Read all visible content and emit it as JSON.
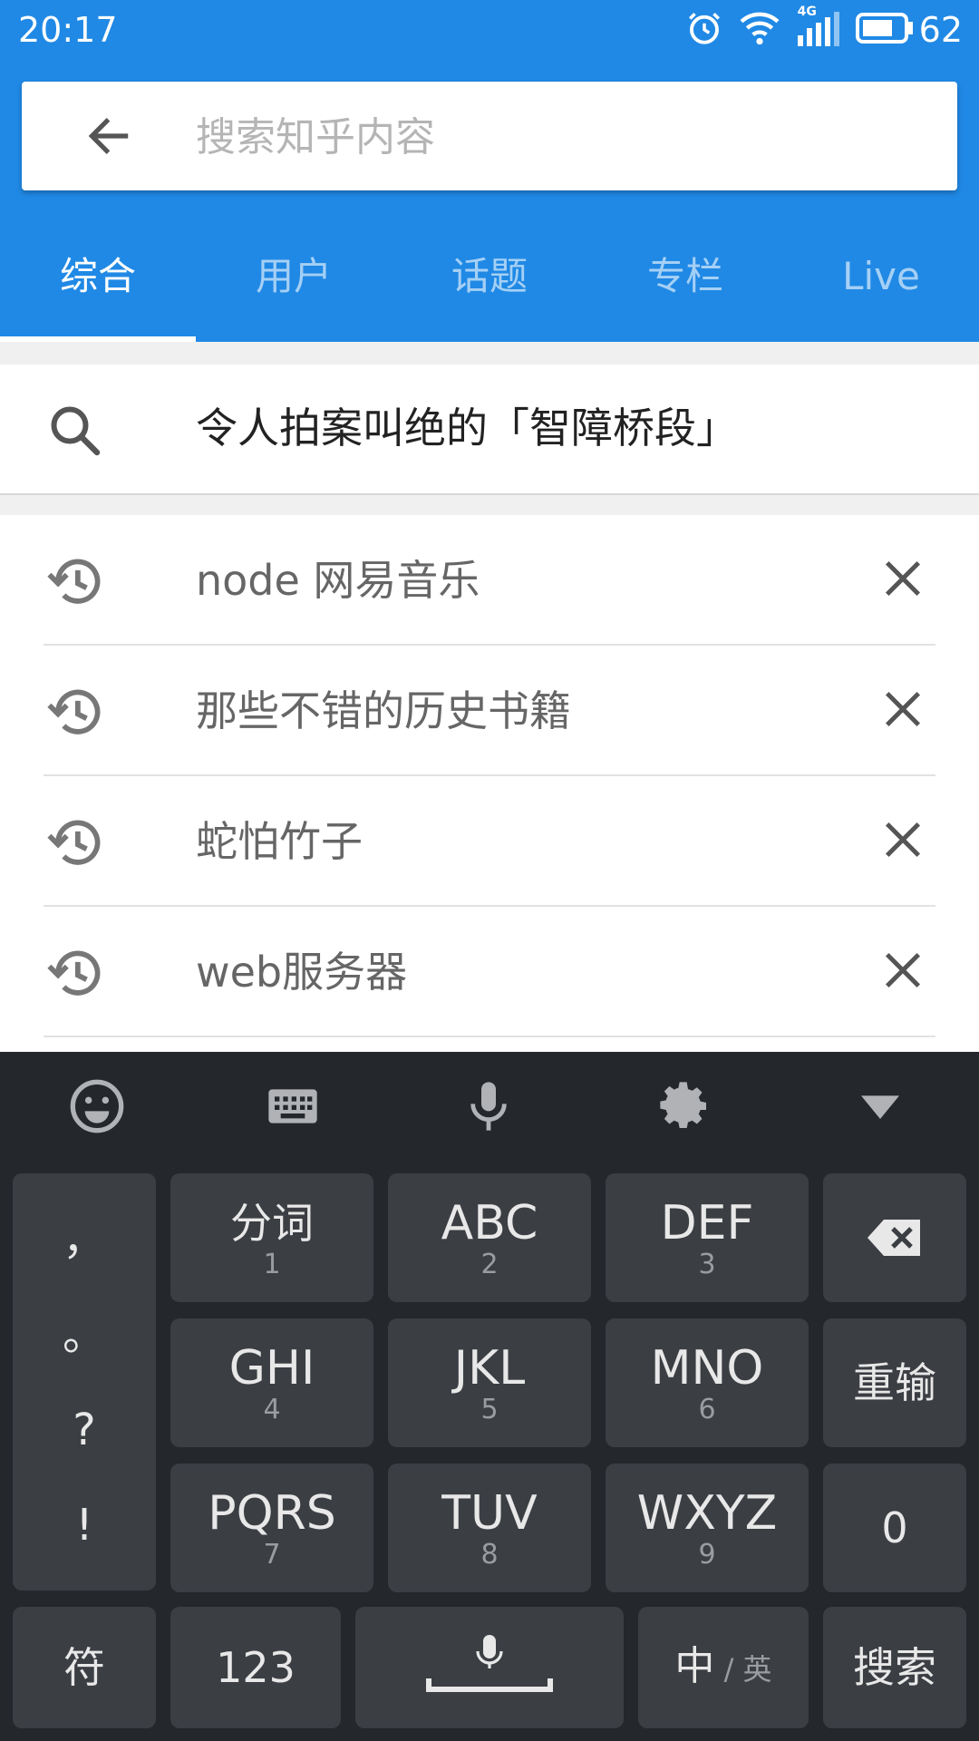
{
  "status_bar": {
    "time": "20:17",
    "battery": "62",
    "network": "4G"
  },
  "search": {
    "placeholder": "搜索知乎内容",
    "value": ""
  },
  "tabs": [
    {
      "label": "综合",
      "active": true
    },
    {
      "label": "用户",
      "active": false
    },
    {
      "label": "话题",
      "active": false
    },
    {
      "label": "专栏",
      "active": false
    },
    {
      "label": "Live",
      "active": false
    }
  ],
  "suggestion": {
    "text": "令人拍案叫绝的「智障桥段」"
  },
  "history": [
    {
      "text": "node 网易音乐"
    },
    {
      "text": "那些不错的历史书籍"
    },
    {
      "text": "蛇怕竹子"
    },
    {
      "text": "web服务器"
    }
  ],
  "keyboard": {
    "punctuation": [
      "，",
      "。",
      "?",
      "!"
    ],
    "keys": {
      "k1": {
        "main": "分词",
        "sub": "1"
      },
      "k2": {
        "main": "ABC",
        "sub": "2"
      },
      "k3": {
        "main": "DEF",
        "sub": "3"
      },
      "k4": {
        "main": "GHI",
        "sub": "4"
      },
      "k5": {
        "main": "JKL",
        "sub": "5"
      },
      "k6": {
        "main": "MNO",
        "sub": "6"
      },
      "k7": {
        "main": "PQRS",
        "sub": "7"
      },
      "k8": {
        "main": "TUV",
        "sub": "8"
      },
      "k9": {
        "main": "WXYZ",
        "sub": "9"
      }
    },
    "reinput": "重输",
    "zero": "0",
    "symbol": "符",
    "num": "123",
    "lang_main": "中",
    "lang_sep": " / ",
    "lang_alt": "英",
    "search_key": "搜索"
  },
  "colors": {
    "accent": "#2089e5",
    "keyboard_bg": "#24272b",
    "key_bg": "#3b3e43"
  }
}
